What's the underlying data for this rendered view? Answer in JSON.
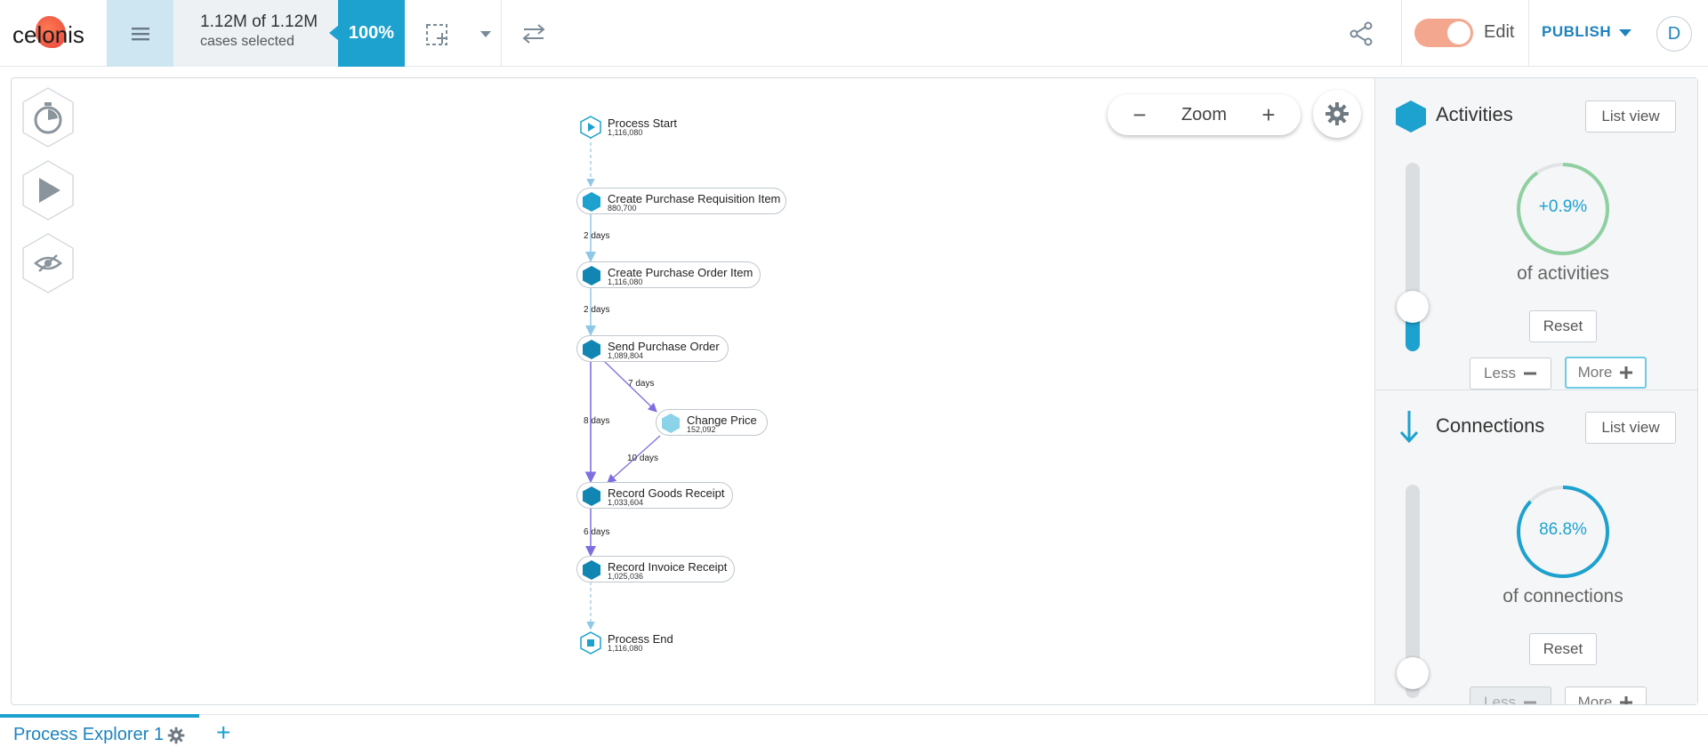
{
  "header": {
    "logo_text": "celonis",
    "cases_main": "1.12M of 1.12M",
    "cases_sub": "cases selected",
    "selection_pct": "100%",
    "edit_label": "Edit",
    "publish_label": "PUBLISH",
    "avatar_initial": "D"
  },
  "canvas": {
    "zoom_minus": "−",
    "zoom_label": "Zoom",
    "zoom_plus": "+"
  },
  "graph": {
    "start": {
      "label": "Process Start",
      "count": "1,116,080"
    },
    "end": {
      "label": "Process End",
      "count": "1,116,080"
    },
    "activities": [
      {
        "label": "Create Purchase Requisition Item",
        "count": "880,700",
        "color": "#1da1cf"
      },
      {
        "label": "Create Purchase Order Item",
        "count": "1,116,080",
        "color": "#1186b3"
      },
      {
        "label": "Send Purchase Order",
        "count": "1,089,804",
        "color": "#1186b3"
      },
      {
        "label": "Change Price",
        "count": "152,092",
        "color": "#8ad3e8"
      },
      {
        "label": "Record Goods Receipt",
        "count": "1,033,604",
        "color": "#1186b3"
      },
      {
        "label": "Record Invoice Receipt",
        "count": "1,025,036",
        "color": "#1186b3"
      }
    ],
    "edge_labels": [
      "2 days",
      "2 days",
      "7 days",
      "8 days",
      "10 days",
      "6 days"
    ]
  },
  "panel": {
    "activities": {
      "title": "Activities",
      "list_view": "List view",
      "ring_value": "+0.9%",
      "ring_fraction": 0.9,
      "ring_color": "#8fd0a0",
      "subtitle": "of activities",
      "reset": "Reset",
      "less": "Less",
      "more": "More"
    },
    "connections": {
      "title": "Connections",
      "list_view": "List view",
      "ring_value": "86.8%",
      "ring_fraction": 0.868,
      "ring_color": "#1da1cf",
      "subtitle": "of connections",
      "reset": "Reset",
      "less": "Less",
      "more": "More"
    }
  },
  "tabs": [
    {
      "label": "Process Explorer 1",
      "active": true
    }
  ],
  "colors": {
    "accent": "#1da1cf",
    "brand_link": "#1d83bf",
    "edit_toggle": "#f4a78f"
  }
}
